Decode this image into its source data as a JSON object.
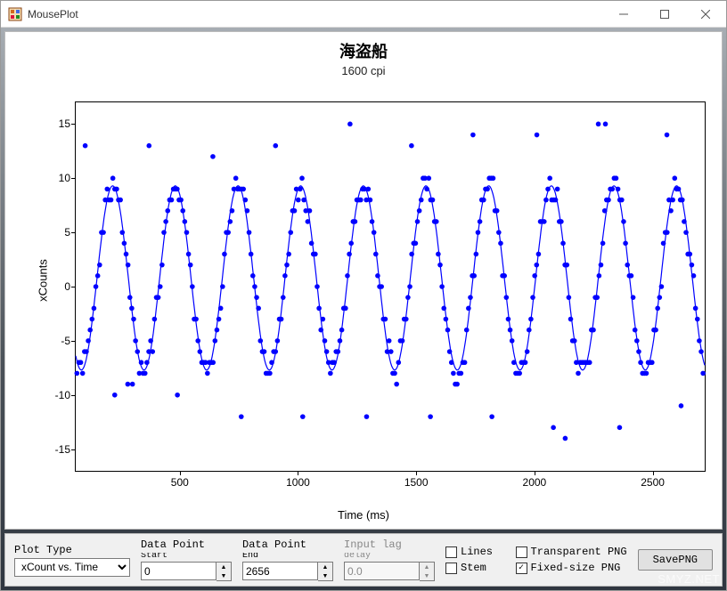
{
  "window": {
    "title": "MousePlot"
  },
  "chart": {
    "title": "海盗船",
    "subtitle": "1600 cpi",
    "xlabel": "Time (ms)",
    "ylabel": "xCounts"
  },
  "chart_data": {
    "type": "scatter",
    "title": "海盗船",
    "subtitle": "1600 cpi",
    "xlabel": "Time (ms)",
    "ylabel": "xCounts",
    "xlim": [
      60,
      2720
    ],
    "ylim": [
      -17,
      17
    ],
    "xticks": [
      500,
      1000,
      1500,
      2000,
      2500
    ],
    "yticks": [
      -15,
      -10,
      -5,
      0,
      5,
      10,
      15
    ],
    "series": [
      {
        "name": "xCount",
        "color": "#0000ff",
        "sinusoid_fit": {
          "amplitude": 8.5,
          "period_ms": 265,
          "phase_ms": 150
        },
        "points_note": "approximately 330 samples at ~8ms intervals oscillating sinusoidally between -8 and +10 with occasional outliers up to ±15",
        "outliers": [
          {
            "x": 100,
            "y": 13
          },
          {
            "x": 370,
            "y": 13
          },
          {
            "x": 640,
            "y": 12
          },
          {
            "x": 905,
            "y": 13
          },
          {
            "x": 1220,
            "y": 15
          },
          {
            "x": 1480,
            "y": 13
          },
          {
            "x": 1740,
            "y": 14
          },
          {
            "x": 2010,
            "y": 14
          },
          {
            "x": 2270,
            "y": 15
          },
          {
            "x": 2300,
            "y": 15
          },
          {
            "x": 2560,
            "y": 14
          },
          {
            "x": 225,
            "y": -10
          },
          {
            "x": 490,
            "y": -10
          },
          {
            "x": 760,
            "y": -12
          },
          {
            "x": 1020,
            "y": -12
          },
          {
            "x": 1290,
            "y": -12
          },
          {
            "x": 1560,
            "y": -12
          },
          {
            "x": 1820,
            "y": -12
          },
          {
            "x": 2080,
            "y": -13
          },
          {
            "x": 2130,
            "y": -14
          },
          {
            "x": 2360,
            "y": -13
          },
          {
            "x": 2620,
            "y": -11
          },
          {
            "x": 280,
            "y": -9
          },
          {
            "x": 300,
            "y": -9
          }
        ]
      }
    ]
  },
  "controls": {
    "plot_type": {
      "label": "Plot Type",
      "value": "xCount vs. Time"
    },
    "data_start": {
      "label": "Data Point",
      "label2": "Start",
      "value": "0"
    },
    "data_end": {
      "label": "Data Point",
      "label2": "End",
      "value": "2656"
    },
    "input_lag": {
      "label": "Input lag",
      "label2": "delay",
      "value": "0.0",
      "disabled": true
    },
    "lines": {
      "label": "Lines",
      "checked": false
    },
    "stem": {
      "label": "Stem",
      "checked": false
    },
    "transparent": {
      "label": "Transparent PNG",
      "checked": false
    },
    "fixed": {
      "label": "Fixed-size PNG",
      "checked": true
    },
    "save": {
      "label": "SavePNG"
    }
  },
  "watermark": "SMYZ.NET"
}
